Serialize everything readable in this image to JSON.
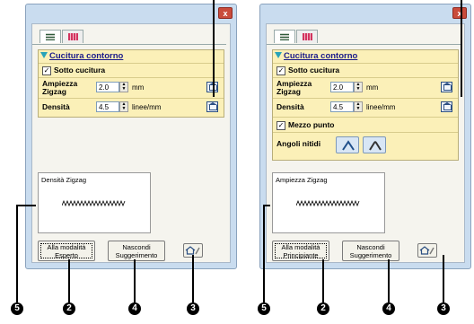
{
  "close_glyph": "x",
  "left_window": {
    "section_title": "Cucitura contorno",
    "under_stitch_label": "Sotto cucitura",
    "zigzag_label_1": "Ampiezza",
    "zigzag_label_2": "Zigzag",
    "zigzag_value": "2.0",
    "zigzag_unit": "mm",
    "density_label": "Densità",
    "density_value": "4.5",
    "density_unit": "linee/mm",
    "hint_title": "Densità Zigzag",
    "mode_button_line1": "Alla modalità",
    "mode_button_line2": "Esperto",
    "hide_button_line1": "Nascondi",
    "hide_button_line2": "Suggerimento"
  },
  "right_window": {
    "section_title": "Cucitura contorno",
    "under_stitch_label": "Sotto cucitura",
    "zigzag_label_1": "Ampiezza",
    "zigzag_label_2": "Zigzag",
    "zigzag_value": "2.0",
    "zigzag_unit": "mm",
    "density_label": "Densità",
    "density_value": "4.5",
    "density_unit": "linee/mm",
    "half_stitch_label": "Mezzo punto",
    "sharp_corners_label": "Angoli nitidi",
    "hint_title": "Ampiezza Zigzag",
    "mode_button_line1": "Alla modalità",
    "mode_button_line2": "Principiante",
    "hide_button_line1": "Nascondi",
    "hide_button_line2": "Suggerimento"
  },
  "markers": {
    "five": "5",
    "two": "2",
    "four": "4",
    "three": "3"
  },
  "icons": [
    "close-icon",
    "stitch-grid-icon",
    "color-pattern-icon",
    "reset-default-icon",
    "check-icon",
    "corner-style-icon",
    "zigzag-preview-icon",
    "settings-house-icon"
  ]
}
